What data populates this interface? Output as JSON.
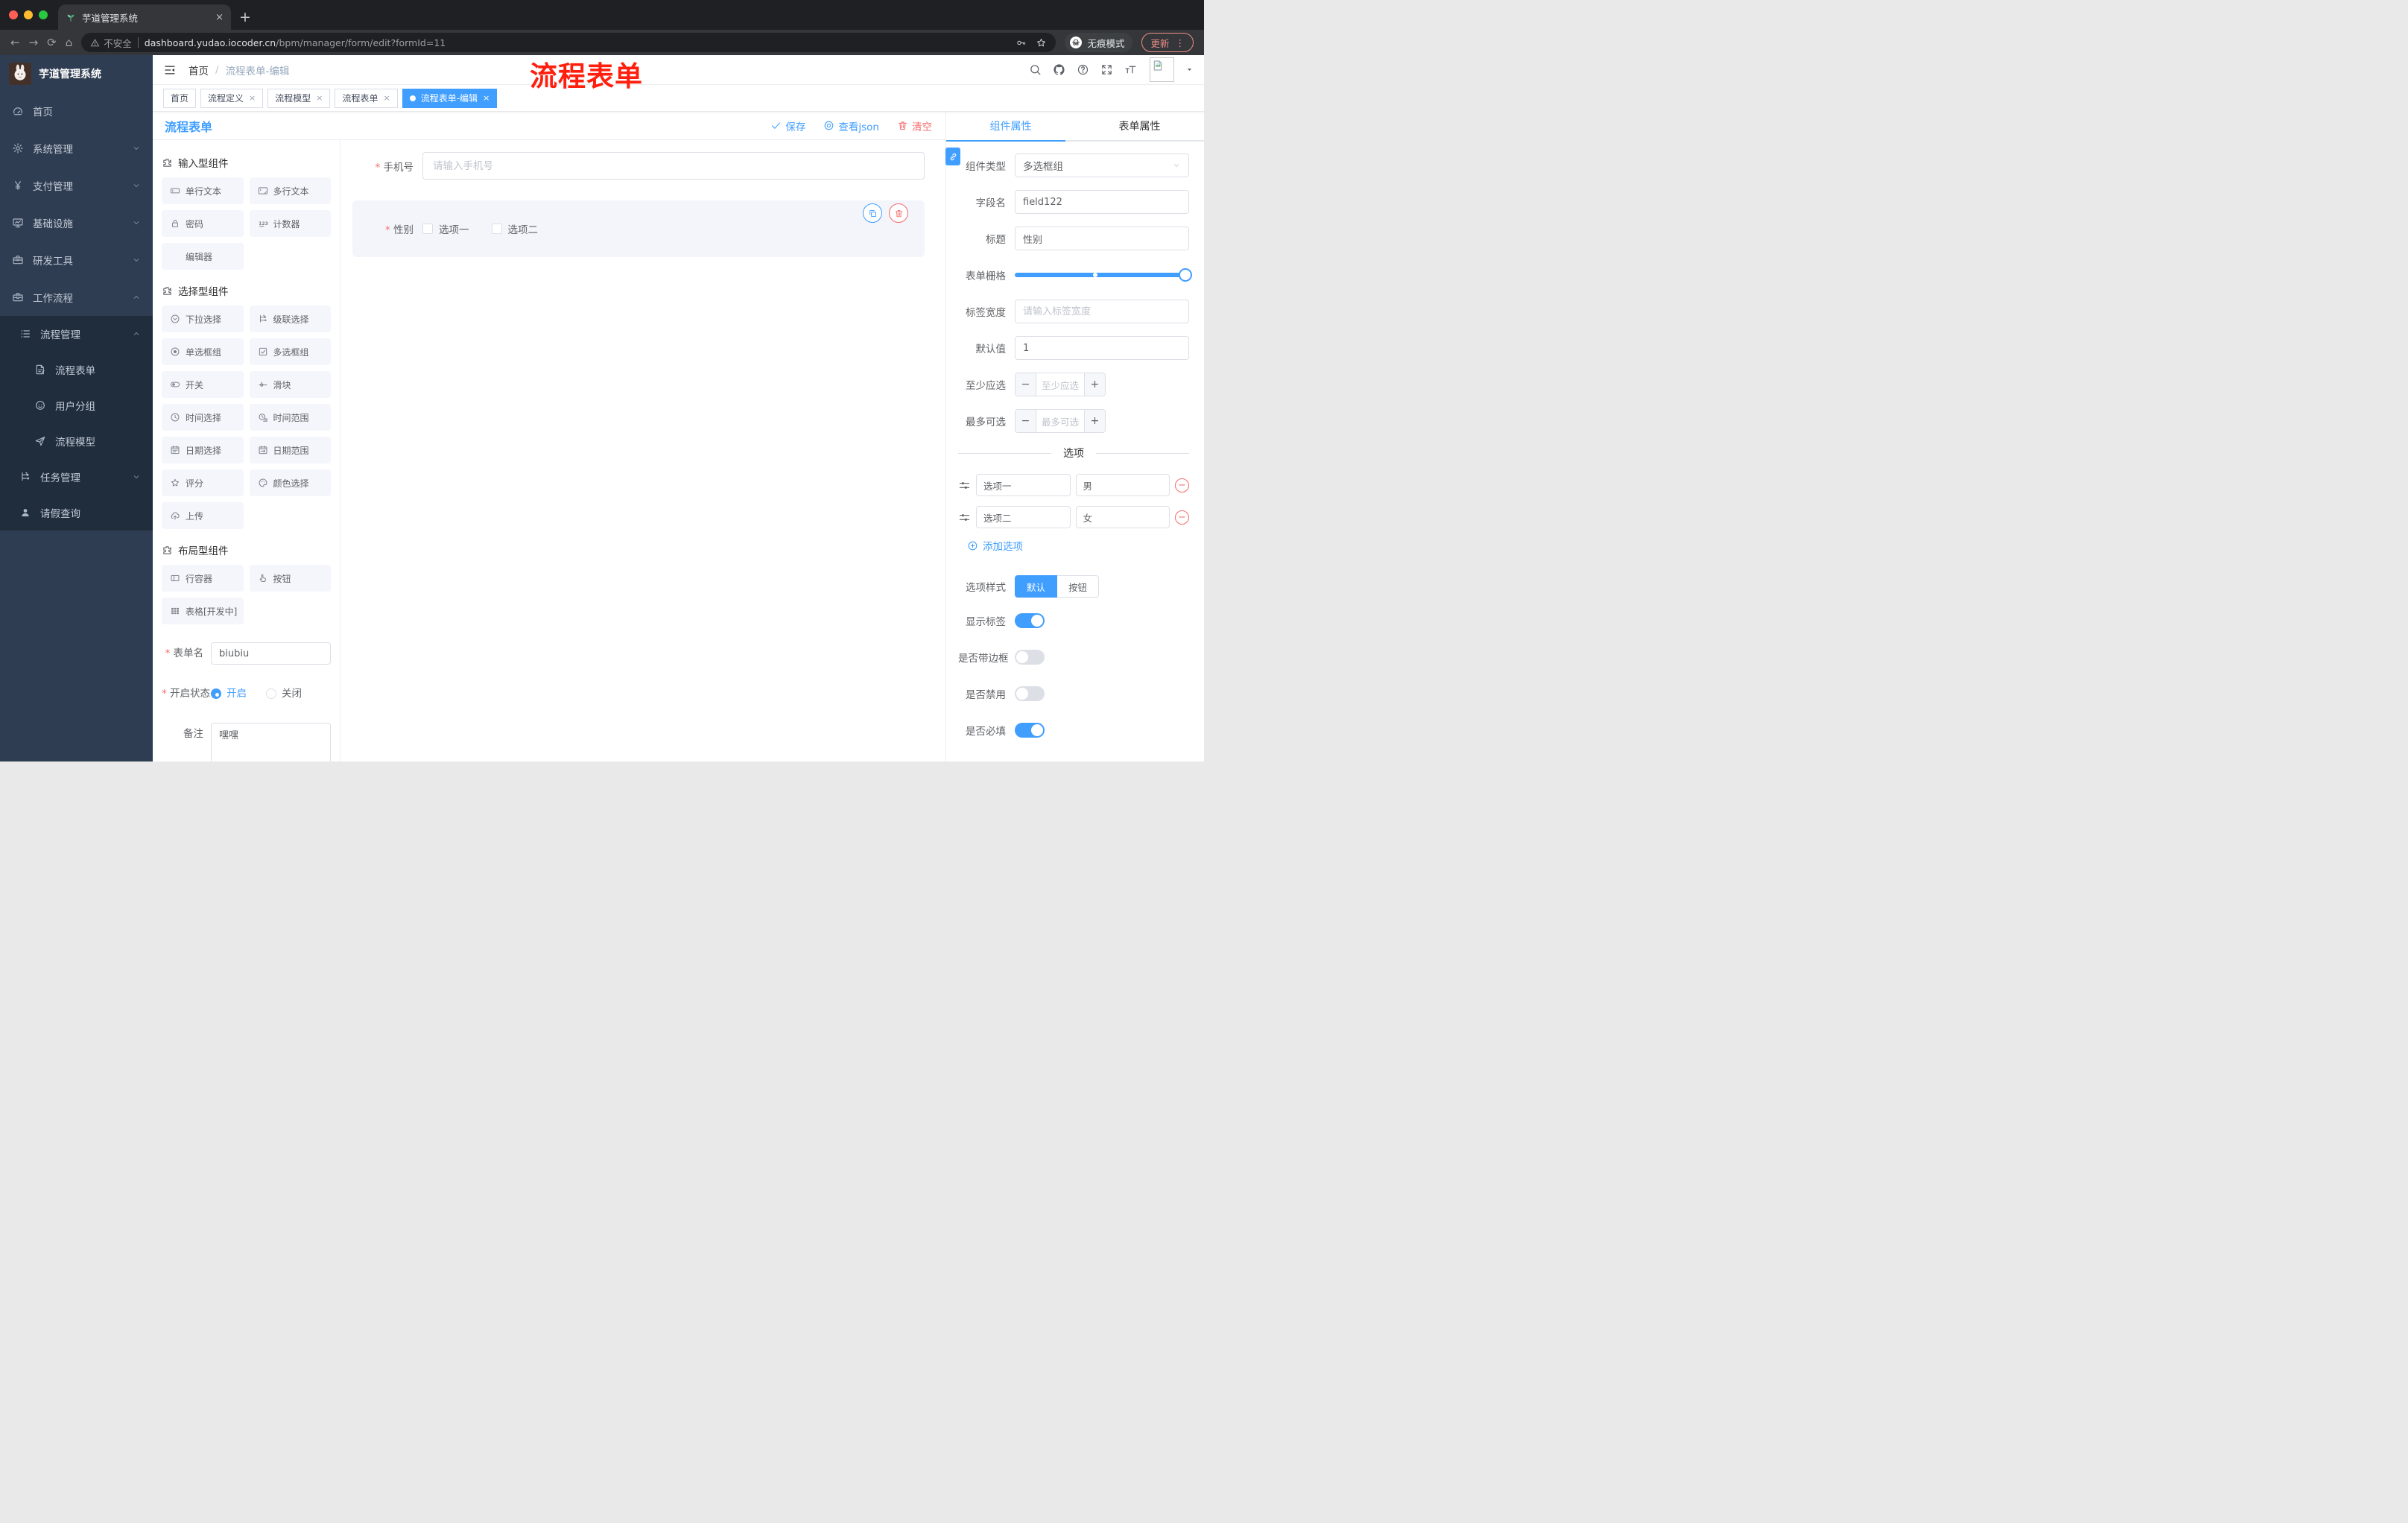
{
  "ui": {
    "close": "×",
    "plus": "+",
    "minus": "−",
    "kebab": "⋮",
    "back": "←",
    "forward": "→",
    "reload": "⟳",
    "home": "⌂",
    "newtab": "+",
    "slash": "/",
    "q": "?"
  },
  "colors": {
    "accent": "#409eff",
    "danger": "#f56c6c",
    "tag_active": "#409eff",
    "annotation": "#ff1f0f",
    "traffic_red": "#ff5f57",
    "traffic_yellow": "#febc2e",
    "traffic_green": "#28c840"
  },
  "browser": {
    "tab_title": "芋道管理系统",
    "security_label": "不安全",
    "url_host": "dashboard.yudao.iocoder.cn",
    "url_path": "/bpm/manager/form/edit?formId=11",
    "incognito_label": "无痕模式",
    "update_label": "更新"
  },
  "annotation": {
    "text": "流程表单"
  },
  "sidebar": {
    "logo_title": "芋道管理系统",
    "items": [
      {
        "label": "首页",
        "icon": "gauge-icon"
      },
      {
        "label": "系统管理",
        "icon": "gear-icon"
      },
      {
        "label": "支付管理",
        "icon": "yen-icon"
      },
      {
        "label": "基础设施",
        "icon": "monitor-icon"
      },
      {
        "label": "研发工具",
        "icon": "toolbox-icon"
      },
      {
        "label": "工作流程",
        "icon": "briefcase-icon"
      },
      {
        "label": "流程管理",
        "icon": "list-icon"
      },
      {
        "label": "流程表单",
        "icon": "document-icon"
      },
      {
        "label": "用户分组",
        "icon": "face-icon"
      },
      {
        "label": "流程模型",
        "icon": "plane-icon"
      },
      {
        "label": "任务管理",
        "icon": "tree-icon"
      },
      {
        "label": "请假查询",
        "icon": "person-icon"
      }
    ]
  },
  "navbar": {
    "breadcrumb": {
      "home": "首页",
      "current": "流程表单-编辑"
    }
  },
  "tags": [
    {
      "label": "首页"
    },
    {
      "label": "流程定义"
    },
    {
      "label": "流程模型"
    },
    {
      "label": "流程表单"
    },
    {
      "label": "流程表单-编辑"
    }
  ],
  "designer": {
    "title": "流程表单",
    "save_label": "保存",
    "view_json_label": "查看json",
    "clear_label": "清空",
    "phone": {
      "label": "手机号",
      "placeholder": "请输入手机号"
    },
    "gender": {
      "label": "性别",
      "option1": "选项一",
      "option2": "选项二"
    }
  },
  "left_panel": {
    "sections": [
      {
        "title": "输入型组件",
        "items": [
          {
            "label": "单行文本",
            "icon": "input-icon"
          },
          {
            "label": "多行文本",
            "icon": "textarea-icon"
          },
          {
            "label": "密码",
            "icon": "lock-icon"
          },
          {
            "label": "计数器",
            "icon": "counter-icon"
          },
          {
            "label": "编辑器",
            "icon": ""
          }
        ]
      },
      {
        "title": "选择型组件",
        "items": [
          {
            "label": "下拉选择",
            "icon": "select-icon"
          },
          {
            "label": "级联选择",
            "icon": "cascader-icon"
          },
          {
            "label": "单选框组",
            "icon": "radio-icon"
          },
          {
            "label": "多选框组",
            "icon": "checkbox-icon"
          },
          {
            "label": "开关",
            "icon": "switch-icon"
          },
          {
            "label": "滑块",
            "icon": "slider-icon"
          },
          {
            "label": "时间选择",
            "icon": "time-icon"
          },
          {
            "label": "时间范围",
            "icon": "time-range-icon"
          },
          {
            "label": "日期选择",
            "icon": "date-icon"
          },
          {
            "label": "日期范围",
            "icon": "date-range-icon"
          },
          {
            "label": "评分",
            "icon": "star-icon"
          },
          {
            "label": "颜色选择",
            "icon": "palette-icon"
          },
          {
            "label": "上传",
            "icon": "upload-icon"
          }
        ]
      },
      {
        "title": "布局型组件",
        "items": [
          {
            "label": "行容器",
            "icon": "row-icon"
          },
          {
            "label": "按钮",
            "icon": "pointer-icon"
          },
          {
            "label": "表格[开发中]",
            "icon": "table-icon"
          }
        ]
      }
    ],
    "form": {
      "name_label": "表单名",
      "name_value": "biubiu",
      "status_label": "开启状态",
      "status_on": "开启",
      "status_off": "关闭",
      "remark_label": "备注",
      "remark_value": "嘿嘿"
    }
  },
  "right_panel": {
    "tabs": [
      {
        "label": "组件属性"
      },
      {
        "label": "表单属性"
      }
    ],
    "fields": {
      "component_type_label": "组件类型",
      "component_type_value": "多选框组",
      "field_name_label": "字段名",
      "field_name_value": "field122",
      "title_label": "标题",
      "title_value": "性别",
      "grid_label": "表单栅格",
      "label_width_label": "标签宽度",
      "label_width_placeholder": "请输入标签宽度",
      "default_label": "默认值",
      "default_value": "1",
      "min_label": "至少应选",
      "min_placeholder": "至少应选",
      "max_label": "最多可选",
      "max_placeholder": "最多可选"
    },
    "options_section": {
      "title": "选项",
      "rows": [
        {
          "name": "选项一",
          "value": "男"
        },
        {
          "name": "选项二",
          "value": "女"
        }
      ],
      "add_label": "添加选项"
    },
    "style": {
      "label": "选项样式",
      "default_label": "默认",
      "button_label": "按钮"
    },
    "switches": [
      {
        "label": "显示标签",
        "on": true
      },
      {
        "label": "是否带边框",
        "on": false
      },
      {
        "label": "是否禁用",
        "on": false
      },
      {
        "label": "是否必填",
        "on": true
      }
    ]
  }
}
